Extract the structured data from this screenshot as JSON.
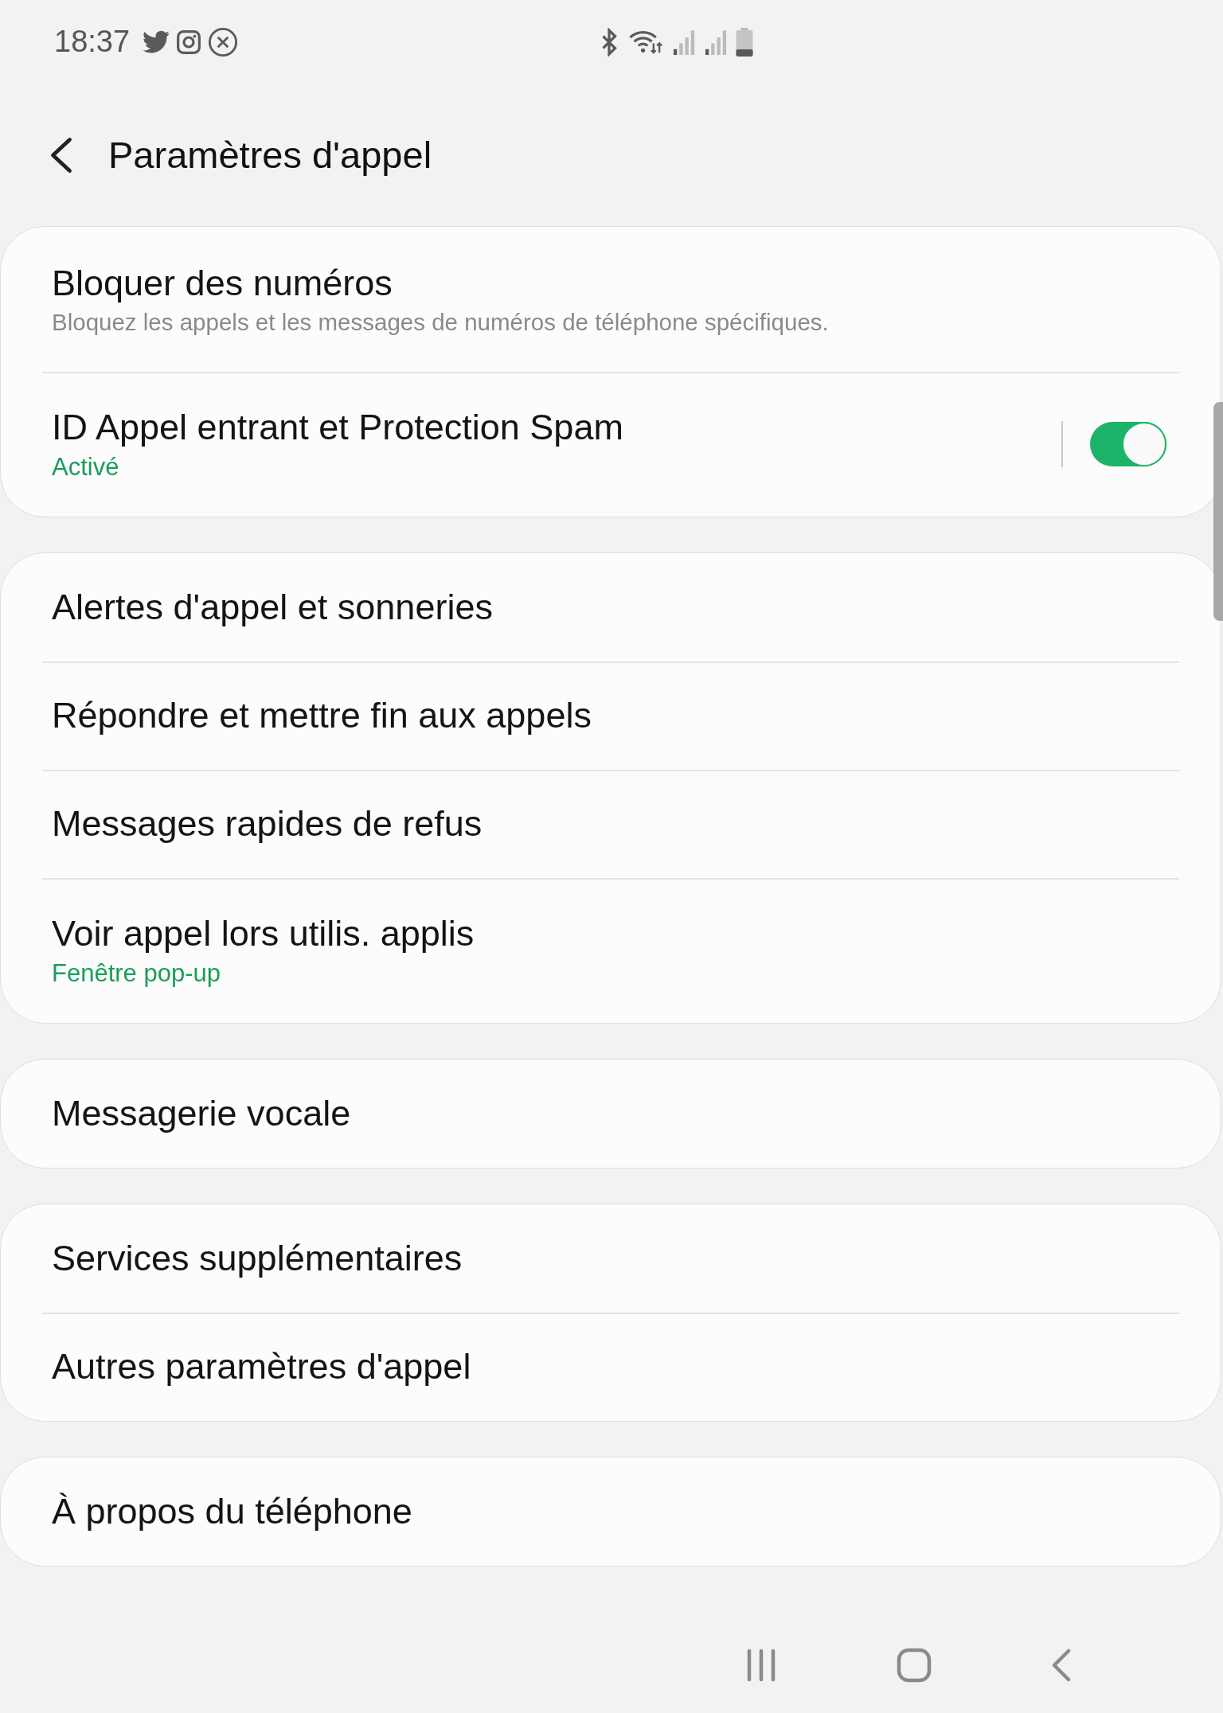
{
  "status_bar": {
    "time": "18:37"
  },
  "header": {
    "title": "Paramètres d'appel"
  },
  "cards": [
    {
      "rows": [
        {
          "title": "Bloquer des numéros",
          "subtitle": "Bloquez les appels et les messages de numéros de téléphone spécifiques."
        },
        {
          "title": "ID Appel entrant et Protection Spam",
          "status": "Activé",
          "toggle": {
            "on": true
          }
        }
      ]
    },
    {
      "rows": [
        {
          "title": "Alertes d'appel et sonneries"
        },
        {
          "title": "Répondre et mettre fin aux appels"
        },
        {
          "title": "Messages rapides de refus"
        },
        {
          "title": "Voir appel lors utilis. applis",
          "status": "Fenêtre pop-up"
        }
      ]
    },
    {
      "rows": [
        {
          "title": "Messagerie vocale"
        }
      ]
    },
    {
      "rows": [
        {
          "title": "Services supplémentaires"
        },
        {
          "title": "Autres paramètres d'appel"
        }
      ]
    },
    {
      "rows": [
        {
          "title": "À propos du téléphone"
        }
      ]
    }
  ]
}
